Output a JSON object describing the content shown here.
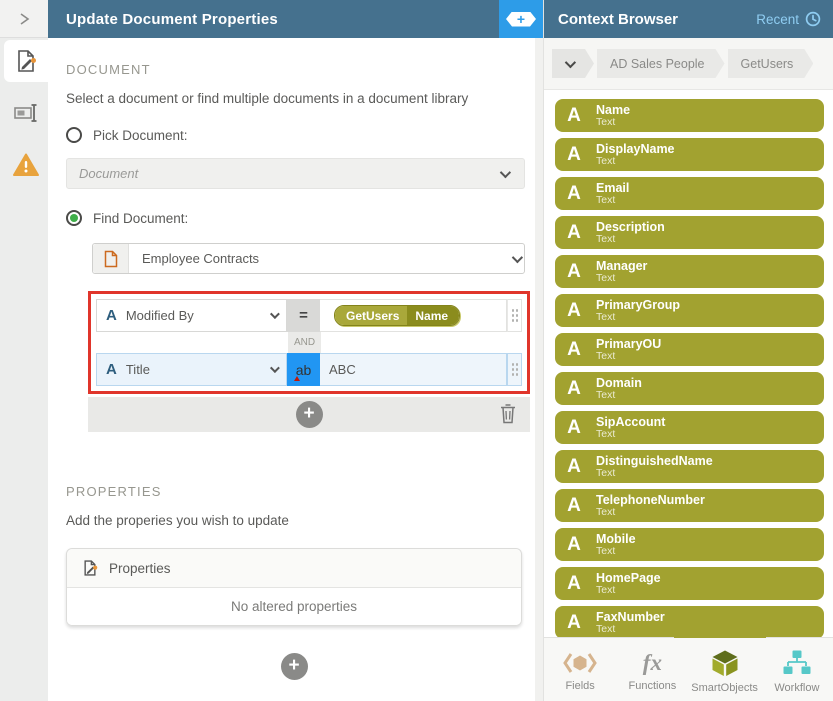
{
  "main": {
    "title": "Update Document Properties",
    "add_context_label": "+",
    "document": {
      "heading": "DOCUMENT",
      "description": "Select a document or find multiple documents in a document library",
      "pick_option": "Pick Document:",
      "pick_placeholder": "Document",
      "find_option": "Find Document:",
      "library": "Employee Contracts",
      "filter": {
        "rows": [
          {
            "field": "Modified By",
            "operator": "=",
            "tag": {
              "source": "GetUsers",
              "property": "Name"
            }
          },
          {
            "field": "Title",
            "operator": "ab",
            "value": "ABC"
          }
        ],
        "connector": "AND",
        "add_label": "+"
      }
    },
    "properties": {
      "heading": "PROPERTIES",
      "description": "Add the properies you wish to update",
      "header_label": "Properties",
      "empty_message": "No altered properties",
      "add_label": "+"
    }
  },
  "context_browser": {
    "title": "Context Browser",
    "recent_label": "Recent",
    "breadcrumb": {
      "items": [
        "AD Sales People",
        "GetUsers"
      ]
    },
    "fields": [
      {
        "name": "Name",
        "type": "Text"
      },
      {
        "name": "DisplayName",
        "type": "Text"
      },
      {
        "name": "Email",
        "type": "Text"
      },
      {
        "name": "Description",
        "type": "Text"
      },
      {
        "name": "Manager",
        "type": "Text"
      },
      {
        "name": "PrimaryGroup",
        "type": "Text"
      },
      {
        "name": "PrimaryOU",
        "type": "Text"
      },
      {
        "name": "Domain",
        "type": "Text"
      },
      {
        "name": "SipAccount",
        "type": "Text"
      },
      {
        "name": "DistinguishedName",
        "type": "Text"
      },
      {
        "name": "TelephoneNumber",
        "type": "Text"
      },
      {
        "name": "Mobile",
        "type": "Text"
      },
      {
        "name": "HomePage",
        "type": "Text"
      },
      {
        "name": "FaxNumber",
        "type": "Text"
      }
    ],
    "tabs": [
      {
        "label": "Fields"
      },
      {
        "label": "Functions"
      },
      {
        "label": "SmartObjects",
        "active": true
      },
      {
        "label": "Workflow"
      }
    ]
  },
  "colors": {
    "header_teal": "#45718e",
    "accent_blue": "#2d9ce8",
    "smartobject_olive": "#a2a230",
    "highlight_red": "#e0352b",
    "warning_orange": "#e8a33d",
    "recent_blue": "#8fcdf2"
  }
}
